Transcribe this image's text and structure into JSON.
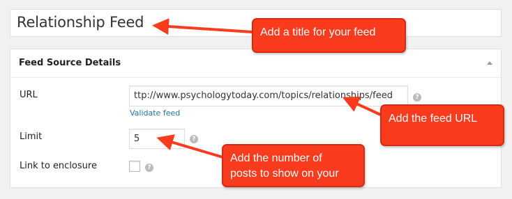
{
  "title_field": {
    "value": "Relationship Feed"
  },
  "panel": {
    "title": "Feed Source Details"
  },
  "fields": {
    "url": {
      "label": "URL",
      "value": "ttp://www.psychologytoday.com/topics/relationships/feed",
      "help_icon": "question-icon",
      "validate_link": "Validate feed"
    },
    "limit": {
      "label": "Limit",
      "value": "5",
      "help_icon": "question-icon"
    },
    "enclosure": {
      "label": "Link to enclosure",
      "checked": false,
      "help_icon": "question-icon"
    }
  },
  "annotations": {
    "title_note": "Add a title for your feed",
    "url_note": "Add the feed URL",
    "limit_note_line1": "Add the number of",
    "limit_note_line2": "posts to show on your"
  },
  "colors": {
    "callout": "#fb3b1d",
    "link": "#21759b",
    "help": "#bbbbbb"
  }
}
